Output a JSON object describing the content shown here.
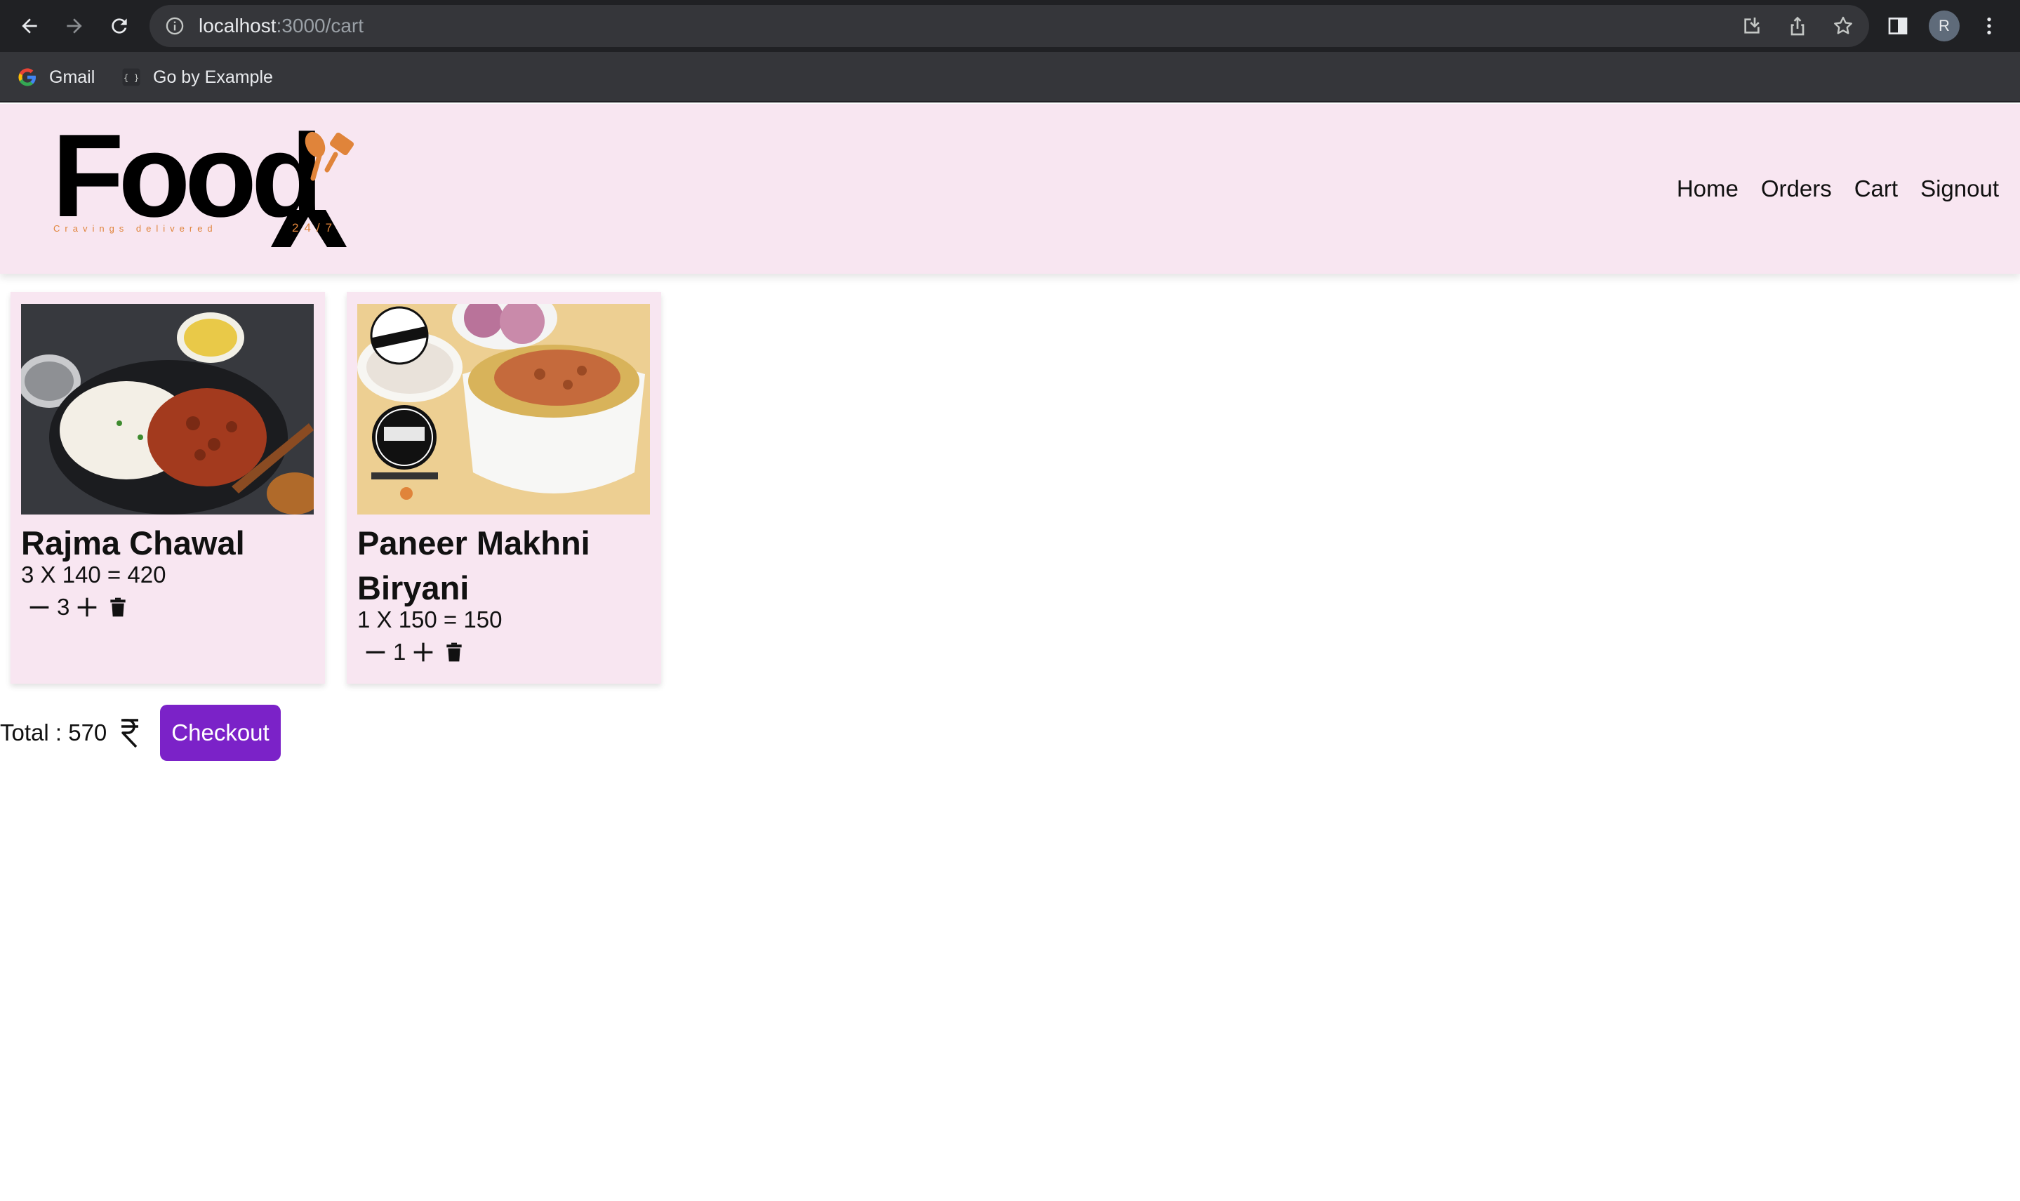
{
  "browser": {
    "url_host": "localhost",
    "url_rest": ":3000/cart",
    "profile_initial": "R",
    "bookmarks": [
      {
        "label": "Gmail",
        "icon": "google-icon"
      },
      {
        "label": "Go by Example",
        "icon": "braces-icon"
      }
    ]
  },
  "site": {
    "logo_word": "Food",
    "logo_tagline": "Cravings delivered",
    "logo_hours": "24/7",
    "nav": [
      "Home",
      "Orders",
      "Cart",
      "Signout"
    ]
  },
  "cart": {
    "items": [
      {
        "name": "Rajma Chawal",
        "calc": "3 X 140 = 420",
        "qty": "3",
        "image": "rajma-chawal-photo"
      },
      {
        "name": "Paneer Makhni Biryani",
        "calc": "1 X 150 = 150",
        "qty": "1",
        "image": "paneer-biryani-photo"
      }
    ],
    "total_label": "Total : 570",
    "currency_icon": "rupee-icon",
    "checkout_label": "Checkout"
  },
  "colors": {
    "header_bg": "#f8e6f1",
    "checkout_bg": "#7b22c8",
    "logo_accent": "#e0843a"
  }
}
